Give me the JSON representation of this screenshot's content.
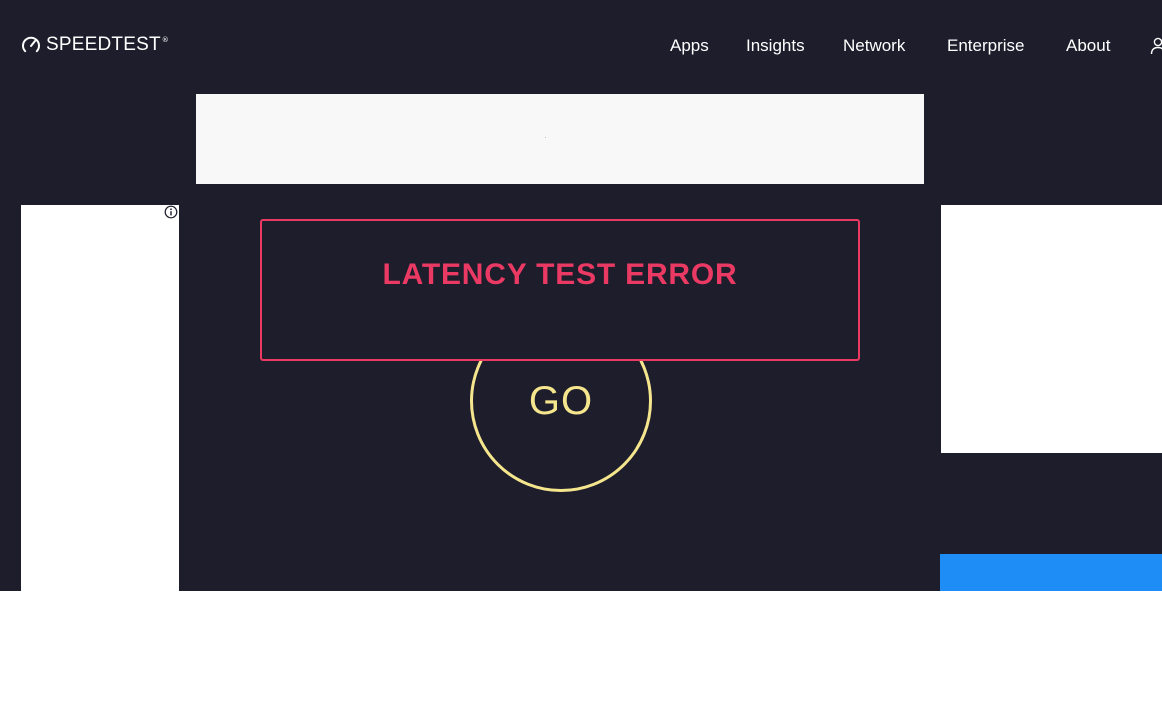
{
  "header": {
    "brand": "SPEEDTEST",
    "trademark": "®",
    "brand_icon": "gauge-icon",
    "nav": [
      {
        "label": "Apps"
      },
      {
        "label": "Insights"
      },
      {
        "label": "Network"
      },
      {
        "label": "Enterprise"
      },
      {
        "label": "About"
      }
    ],
    "user_icon": "user-icon"
  },
  "main": {
    "error_message": "LATENCY TEST ERROR",
    "go_label": "GO"
  },
  "ads": {
    "adchoices_icon": "info-icon"
  },
  "colors": {
    "background": "#1d1d2c",
    "error": "#ea3a63",
    "go_ring": "#f5e68e",
    "accent_blue": "#1e8df5",
    "nav_text": "#ffffff"
  }
}
